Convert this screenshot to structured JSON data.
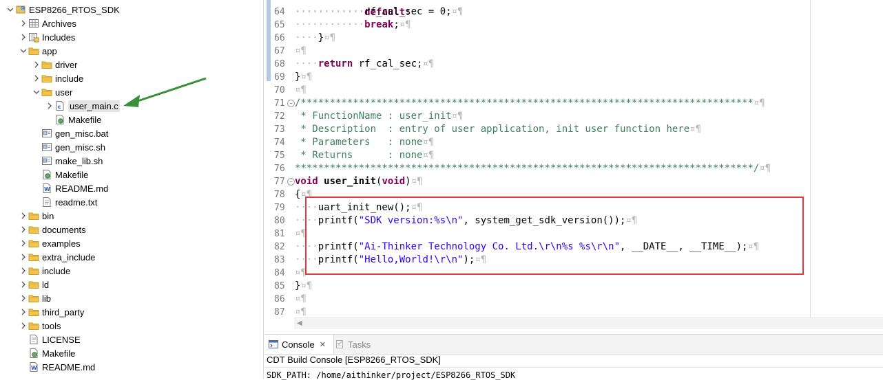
{
  "explorer": {
    "items": [
      {
        "label": "ESP8266_RTOS_SDK",
        "icon": "project-icon",
        "expanded": true
      },
      {
        "label": "Archives",
        "icon": "archives-icon"
      },
      {
        "label": "Includes",
        "icon": "includes-icon"
      },
      {
        "label": "app",
        "icon": "folder-icon",
        "expanded": true
      },
      {
        "label": "driver",
        "icon": "folder-icon"
      },
      {
        "label": "include",
        "icon": "folder-icon"
      },
      {
        "label": "user",
        "icon": "folder-icon",
        "expanded": true
      },
      {
        "label": "user_main.c",
        "icon": "c-file-icon",
        "selected": true
      },
      {
        "label": "Makefile",
        "icon": "makefile-icon"
      },
      {
        "label": "gen_misc.bat",
        "icon": "script-file-icon"
      },
      {
        "label": "gen_misc.sh",
        "icon": "script-file-icon"
      },
      {
        "label": "make_lib.sh",
        "icon": "script-file-icon"
      },
      {
        "label": "Makefile",
        "icon": "makefile-icon"
      },
      {
        "label": "README.md",
        "icon": "word-file-icon"
      },
      {
        "label": "readme.txt",
        "icon": "text-file-icon"
      },
      {
        "label": "bin",
        "icon": "folder-icon"
      },
      {
        "label": "documents",
        "icon": "folder-icon"
      },
      {
        "label": "examples",
        "icon": "folder-icon"
      },
      {
        "label": "extra_include",
        "icon": "folder-icon"
      },
      {
        "label": "include",
        "icon": "folder-icon"
      },
      {
        "label": "ld",
        "icon": "folder-icon"
      },
      {
        "label": "lib",
        "icon": "folder-icon"
      },
      {
        "label": "third_party",
        "icon": "folder-icon"
      },
      {
        "label": "tools",
        "icon": "folder-icon"
      },
      {
        "label": "LICENSE",
        "icon": "text-file-icon"
      },
      {
        "label": "Makefile",
        "icon": "makefile-icon"
      },
      {
        "label": "README.md",
        "icon": "word-file-icon"
      }
    ]
  },
  "editor": {
    "lines": [
      {
        "num": "64",
        "code": "            rf_cal_sec = 0;"
      },
      {
        "num": "65",
        "code": "            break;"
      },
      {
        "num": "66",
        "code": "    }"
      },
      {
        "num": "67",
        "code": ""
      },
      {
        "num": "68",
        "code": "    return rf_cal_sec;"
      },
      {
        "num": "69",
        "code": "}"
      },
      {
        "num": "70",
        "code": ""
      },
      {
        "num": "71",
        "code": "/******************************************************************************"
      },
      {
        "num": "72",
        "code": " * FunctionName : user_init"
      },
      {
        "num": "73",
        "code": " * Description  : entry of user application, init user function here"
      },
      {
        "num": "74",
        "code": " * Parameters   : none"
      },
      {
        "num": "75",
        "code": " * Returns      : none"
      },
      {
        "num": "76",
        "code": "*******************************************************************************/"
      },
      {
        "num": "77",
        "code": "void user_init(void)"
      },
      {
        "num": "78",
        "code": "{"
      },
      {
        "num": "79",
        "code": "    uart_init_new();"
      },
      {
        "num": "80",
        "code": "    printf(\"SDK version:%s\\n\", system_get_sdk_version());"
      },
      {
        "num": "81",
        "code": ""
      },
      {
        "num": "82",
        "code": "    printf(\"Ai-Thinker Technology Co. Ltd.\\r\\n%s %s\\r\\n\", __DATE__, __TIME__);"
      },
      {
        "num": "83",
        "code": "    printf(\"Hello,World!\\r\\n\");"
      },
      {
        "num": "84",
        "code": ""
      },
      {
        "num": "85",
        "code": "}"
      },
      {
        "num": "86",
        "code": ""
      },
      {
        "num": "87",
        "code": ""
      }
    ],
    "partial_top_line": "default:",
    "highlight_color": "#e3393c"
  },
  "console": {
    "tab_console": "Console",
    "tab_tasks": "Tasks",
    "title": "CDT Build Console [ESP8266_RTOS_SDK]",
    "output": "SDK_PATH: /home/aithinker/project/ESP8266_RTOS_SDK"
  },
  "colors": {
    "keyword": "#7f0055",
    "comment": "#3f7f5f",
    "string": "#2a00ff",
    "arrow": "#3a8f3a"
  }
}
